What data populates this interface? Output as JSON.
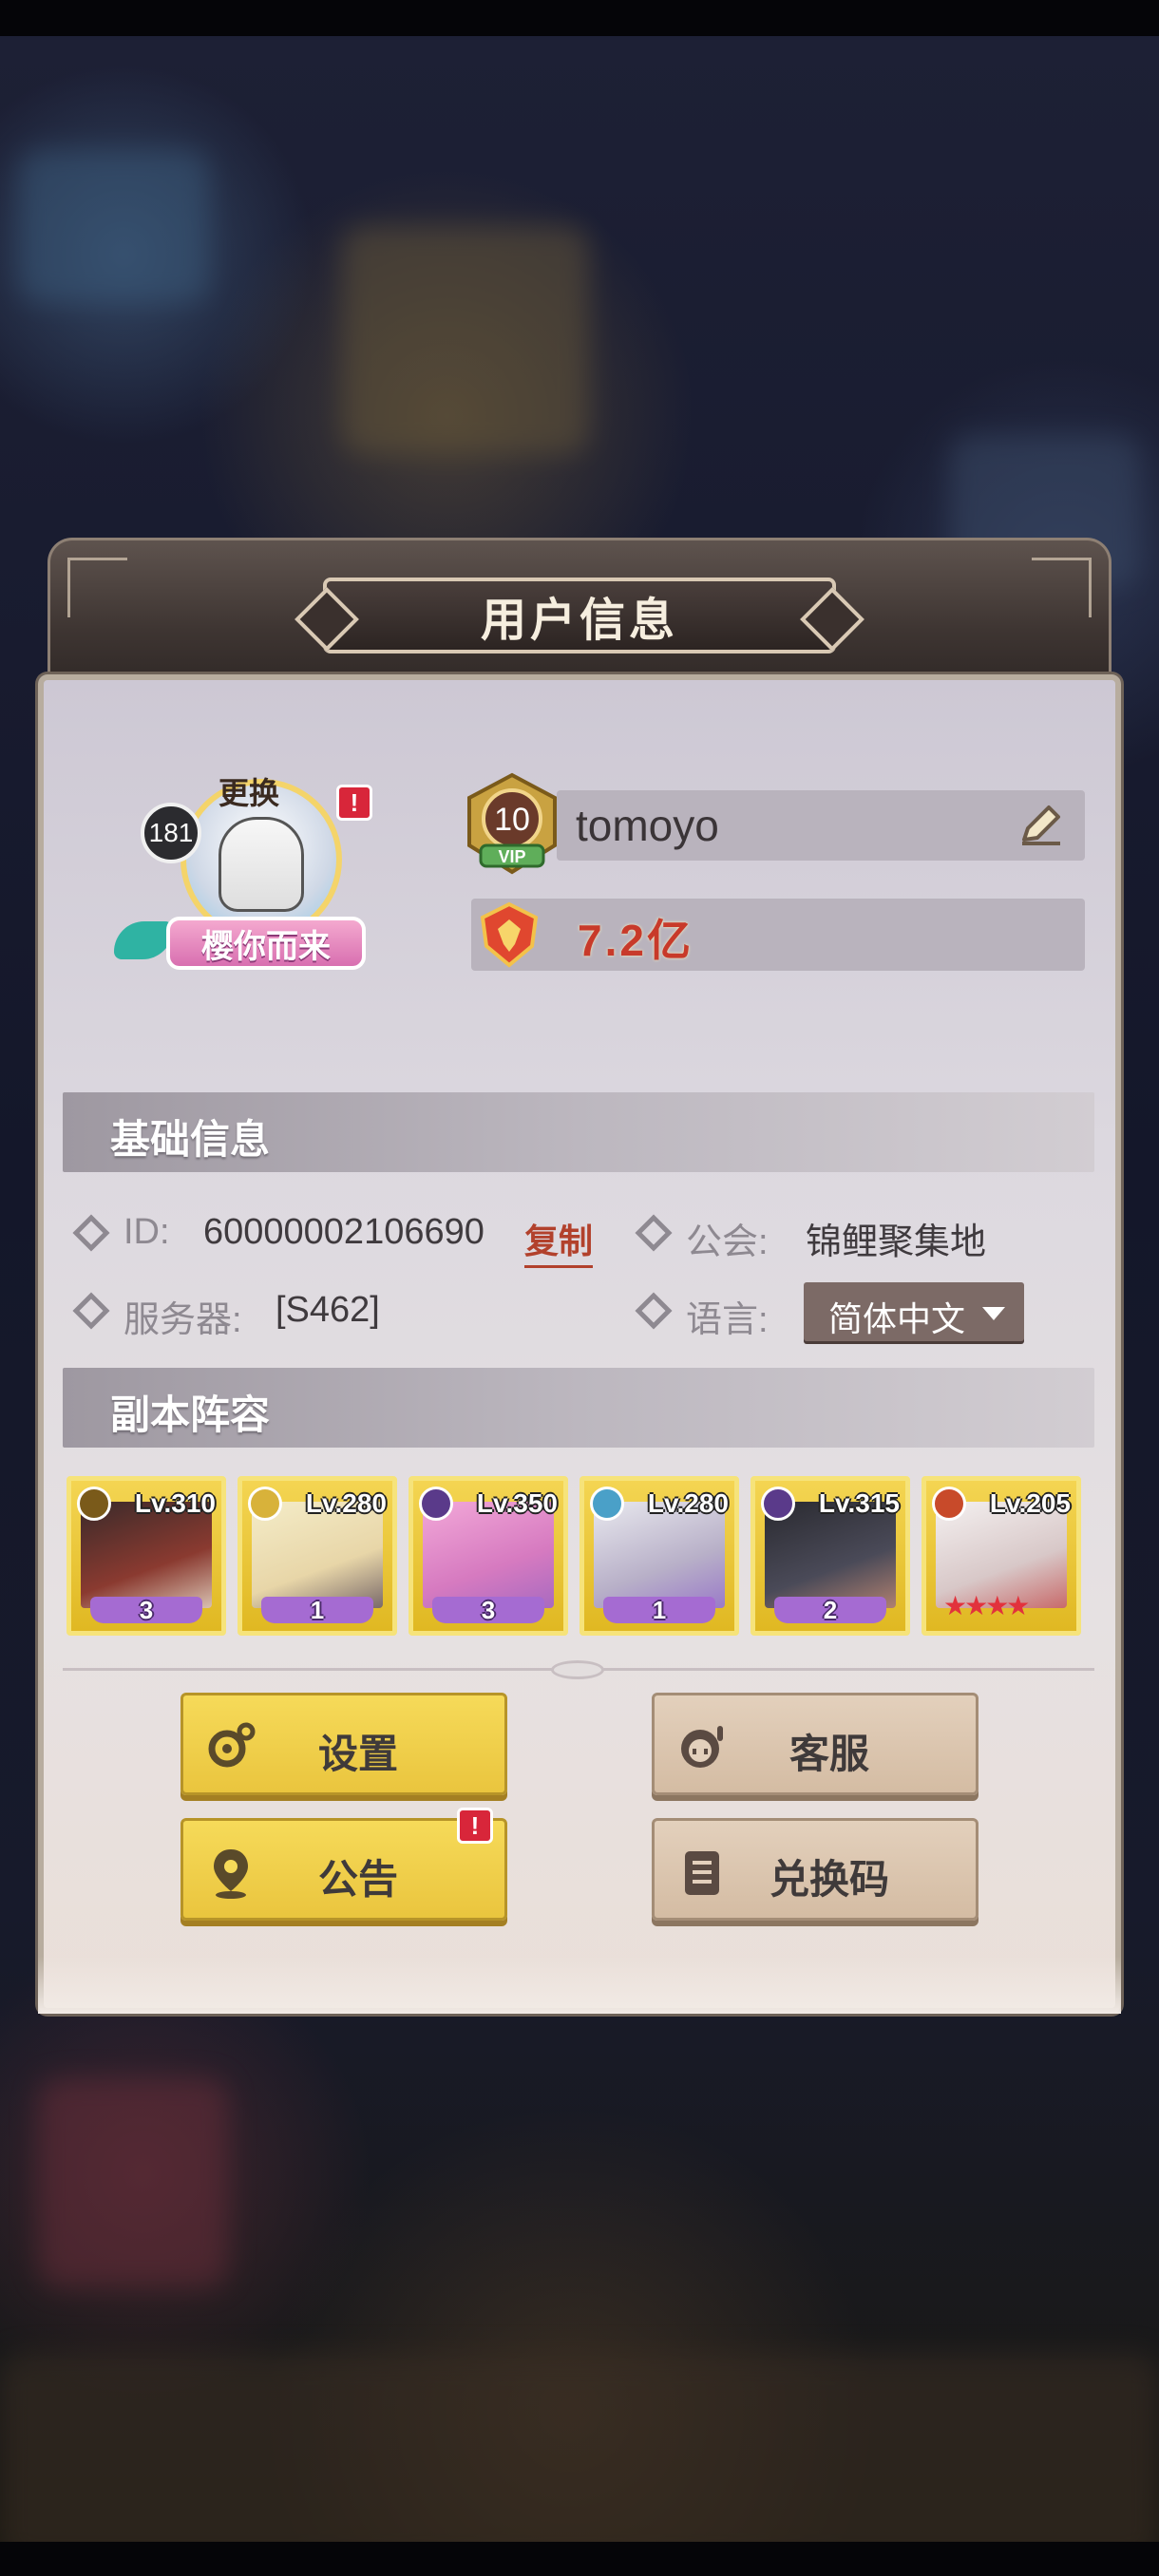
{
  "dialog": {
    "title": "用户信息"
  },
  "profile": {
    "avatar_level": "181",
    "change_label": "更换",
    "avatar_title": "樱你而来",
    "vip_level": "10",
    "vip_label": "VIP",
    "username": "tomoyo",
    "power": "7.2亿"
  },
  "basic_info": {
    "header": "基础信息",
    "id_label": "ID:",
    "id_value": "60000002106690",
    "copy_label": "复制",
    "guild_label": "公会:",
    "guild_value": "锦鲤聚集地",
    "server_label": "服务器:",
    "server_value": "[S462]",
    "language_label": "语言:",
    "language_value": "简体中文"
  },
  "lineup": {
    "header": "副本阵容",
    "heroes": [
      {
        "level": "Lv.310",
        "stars": "3",
        "element": "dark-gold"
      },
      {
        "level": "Lv.280",
        "stars": "1",
        "element": "light"
      },
      {
        "level": "Lv.350",
        "stars": "3",
        "element": "dark"
      },
      {
        "level": "Lv.280",
        "stars": "1",
        "element": "water"
      },
      {
        "level": "Lv.315",
        "stars": "2",
        "element": "dark"
      },
      {
        "level": "Lv.205",
        "stars": "★★★★",
        "element": "fire"
      }
    ]
  },
  "buttons": {
    "settings": "设置",
    "support": "客服",
    "notice": "公告",
    "redeem": "兑换码"
  },
  "colors": {
    "accent_yellow": "#f6da59",
    "tan_button": "#e3d0bc",
    "power_red": "#c83a2a",
    "alert_red": "#d8263a"
  }
}
